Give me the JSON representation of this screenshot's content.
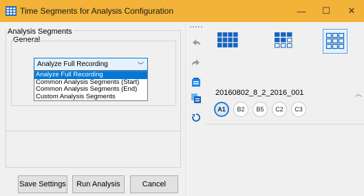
{
  "window": {
    "title": "Time Segments for Analysis Configuration",
    "minimize": "—",
    "maximize": "☐",
    "close": "✕"
  },
  "left": {
    "group_title": "Analysis Segments",
    "subgroup_title": "General",
    "combo_value": "Analyze Full Recording",
    "options": [
      "Analyze Full Recording",
      "Common Analysis Segments (Start)",
      "Common Analysis Segments (End)",
      "Custom Analysis Segments"
    ],
    "selected_index": 0
  },
  "buttons": {
    "save": "Save Settings",
    "run": "Run Analysis",
    "cancel": "Cancel"
  },
  "toolbar": {
    "icons": [
      "undo-icon",
      "redo-icon",
      "paste-icon",
      "copy-icon",
      "refresh-icon"
    ]
  },
  "right": {
    "layouts": [
      "layout-4x3-icon",
      "layout-3x2-icon",
      "layout-grid-outline-icon"
    ],
    "active_layout": 2,
    "dataset": "20160802_8_2_2016_001",
    "chips": [
      "A1",
      "B2",
      "B5",
      "C2",
      "C3"
    ],
    "active_chip": 0
  },
  "colors": {
    "titlebar": "#f3b238",
    "accent": "#0078d7",
    "icon_blue": "#1565c0"
  }
}
